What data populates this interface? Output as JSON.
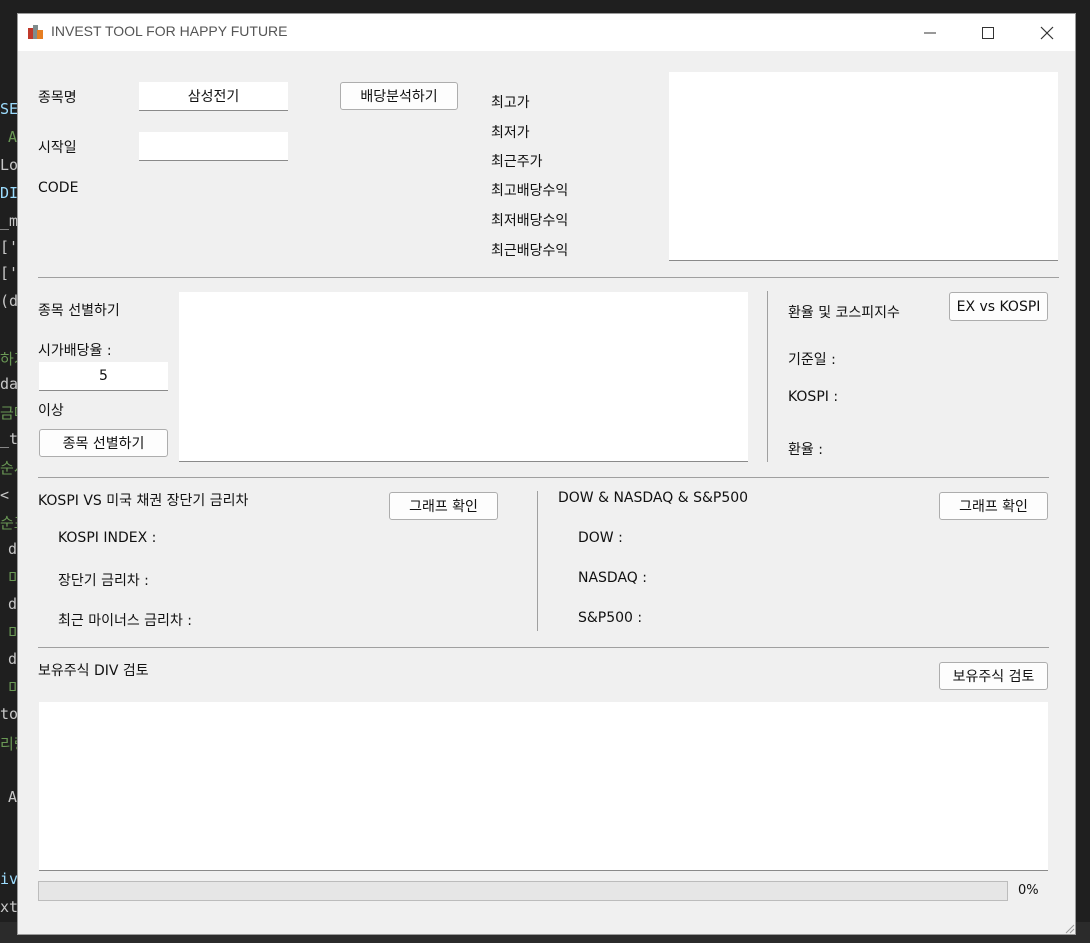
{
  "window": {
    "title": "INVEST TOOL FOR HAPPY FUTURE"
  },
  "stock_info": {
    "name_label": "종목명",
    "name_value": "삼성전기",
    "start_label": "시작일",
    "start_value": "",
    "code_label": "CODE",
    "dividend_button": "배당분석하기",
    "stats": [
      "최고가",
      "최저가",
      "최근주가",
      "최고배당수익",
      "최저배당수익",
      "최근배당수익"
    ]
  },
  "selection": {
    "title": "종목 선별하기",
    "yield_label": "시가배당율 :",
    "yield_value": "5",
    "above_label": "이상",
    "button": "종목 선별하기"
  },
  "exchange": {
    "title": "환율 및 코스피지수",
    "button": "EX vs KOSPI",
    "date_label": "기준일 :",
    "kospi_label": "KOSPI :",
    "rate_label": "환율 :"
  },
  "bond": {
    "title": "KOSPI VS 미국 채권 장단기 금리차",
    "button": "그래프 확인",
    "kospi_label": "KOSPI INDEX :",
    "spread_label": "장단기 금리차 :",
    "negative_label": "최근 마이너스 금리차 :"
  },
  "us_index": {
    "title": "DOW & NASDAQ & S&P500",
    "button": "그래프 확인",
    "dow_label": "DOW :",
    "nasdaq_label": "NASDAQ :",
    "sp_label": "S&P500 :"
  },
  "holdings": {
    "title": "보유주식 DIV 검토",
    "button": "보유주식 검토"
  },
  "progress": {
    "value": 0,
    "label": "0%"
  }
}
